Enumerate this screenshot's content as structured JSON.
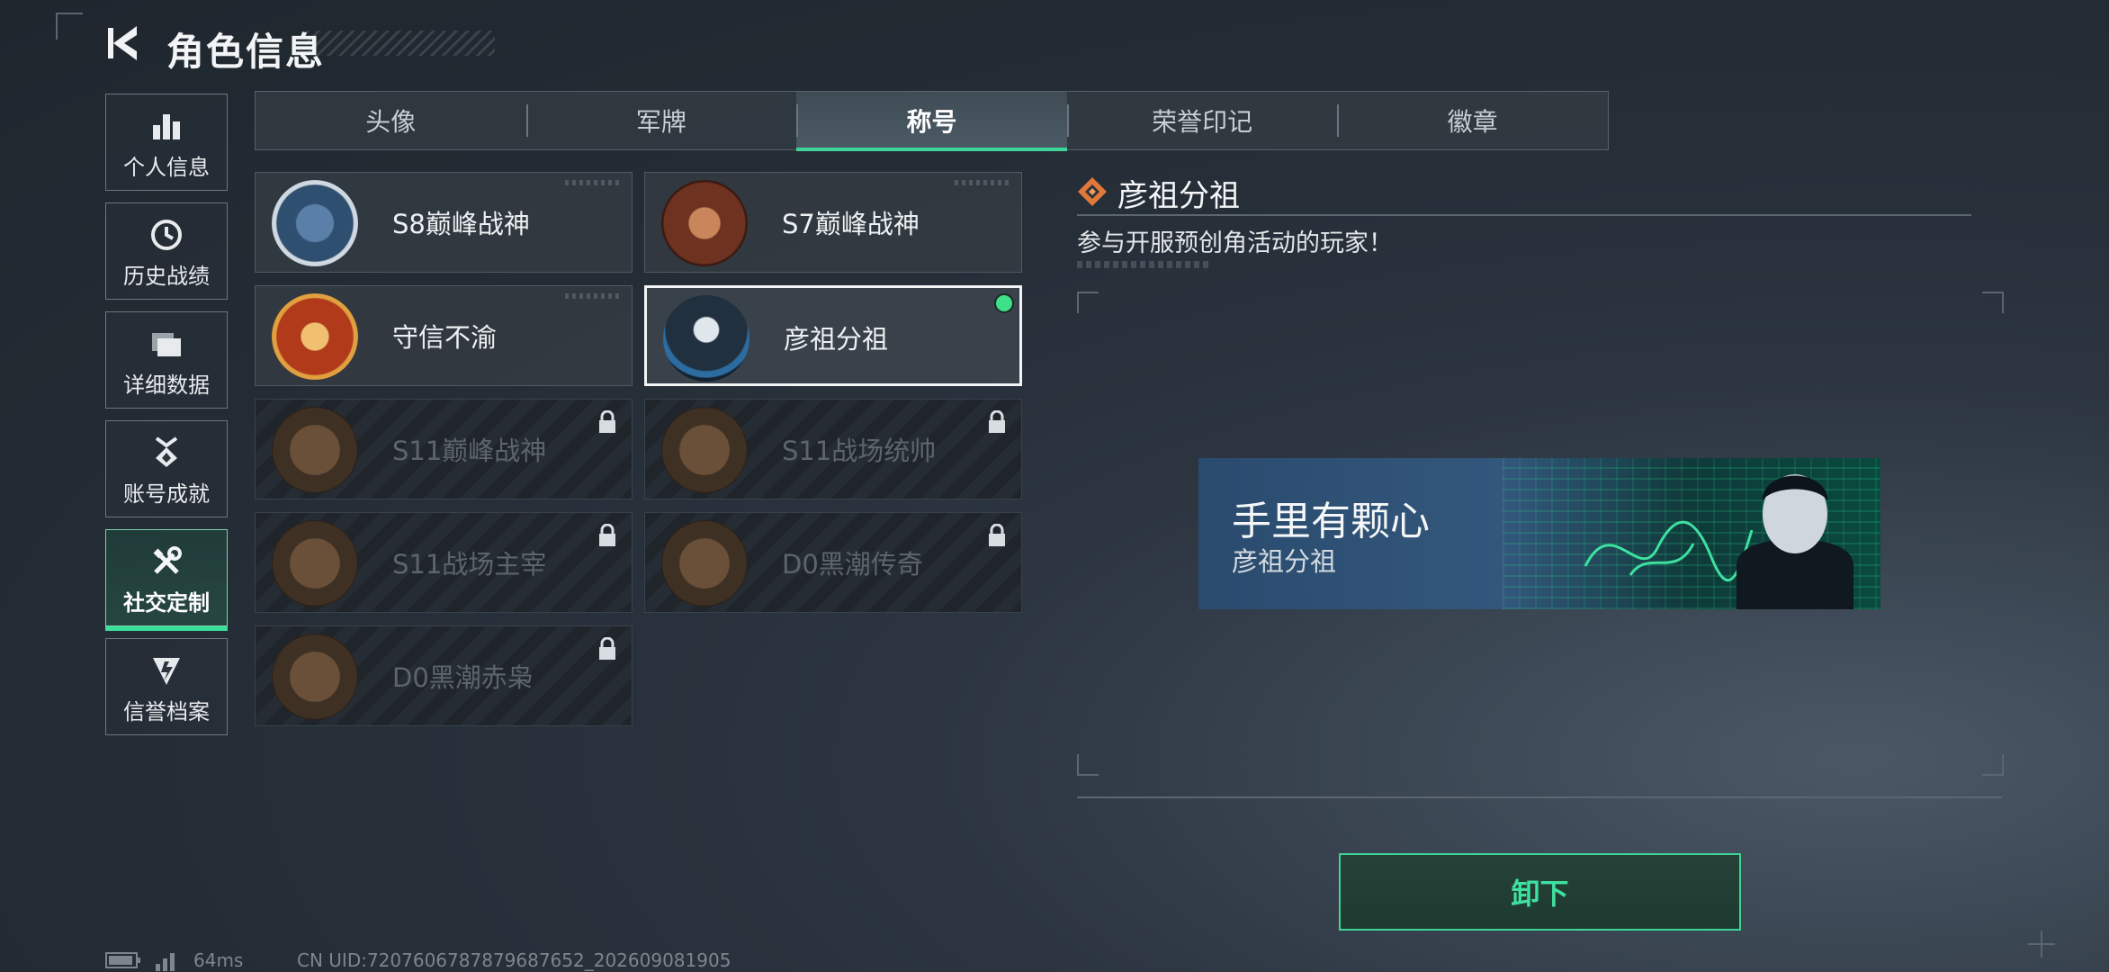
{
  "header": {
    "title": "角色信息"
  },
  "sidebar": {
    "items": [
      {
        "label": "个人信息",
        "icon": "bar-chart-icon"
      },
      {
        "label": "历史战绩",
        "icon": "clock-icon"
      },
      {
        "label": "详细数据",
        "icon": "folder-icon"
      },
      {
        "label": "账号成就",
        "icon": "medal-icon"
      },
      {
        "label": "社交定制",
        "icon": "tools-icon",
        "active": true
      },
      {
        "label": "信誉档案",
        "icon": "shield-bolt-icon"
      }
    ]
  },
  "tabs": [
    {
      "label": "头像"
    },
    {
      "label": "军牌"
    },
    {
      "label": "称号",
      "active": true
    },
    {
      "label": "荣誉印记"
    },
    {
      "label": "徽章"
    }
  ],
  "titles": [
    {
      "name": "S8巅峰战神",
      "locked": false
    },
    {
      "name": "S7巅峰战神",
      "locked": false
    },
    {
      "name": "守信不渝",
      "locked": false
    },
    {
      "name": "彦祖分祖",
      "locked": false,
      "selected": true,
      "equipped": true
    },
    {
      "name": "S11巅峰战神",
      "locked": true
    },
    {
      "name": "S11战场统帅",
      "locked": true
    },
    {
      "name": "S11战场主宰",
      "locked": true
    },
    {
      "name": "D0黑潮传奇",
      "locked": true
    },
    {
      "name": "D0黑潮赤枭",
      "locked": true
    }
  ],
  "detail": {
    "title": "彦祖分祖",
    "description": "参与开服预创角活动的玩家！",
    "banner_line1": "手里有颗心",
    "banner_line2": "彦祖分祖",
    "unequip_label": "卸下"
  },
  "status": {
    "ping": "64ms",
    "uid": "CN UID:7207606787879687652_202609081905"
  },
  "colors": {
    "accent": "#3fd59a",
    "equipped_dot": "#3ee08a"
  }
}
